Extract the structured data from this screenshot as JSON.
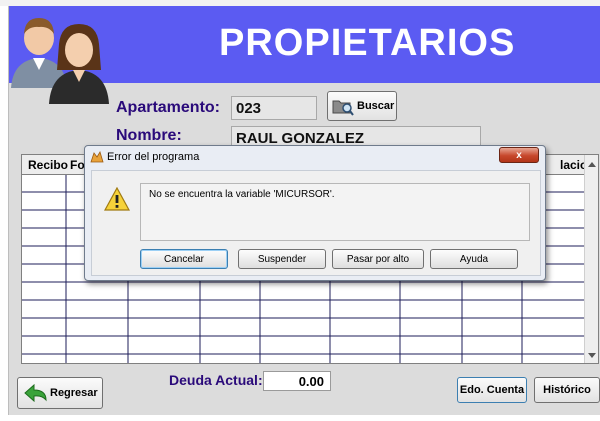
{
  "banner": {
    "title": "PROPIETARIOS"
  },
  "apartamento": {
    "label": "Apartamento:",
    "value": "023"
  },
  "buscar_button": {
    "label": "Buscar"
  },
  "nombre": {
    "label": "Nombre:",
    "value": "RAUL GONZALEZ"
  },
  "grid": {
    "headers": [
      "Recibo",
      "Fo",
      "lacion"
    ]
  },
  "dialog": {
    "title": "Error del programa",
    "message": "No se encuentra la variable 'MICURSOR'.",
    "buttons": {
      "cancel": "Cancelar",
      "suspend": "Suspender",
      "skip": "Pasar por alto",
      "help": "Ayuda"
    },
    "close": "x"
  },
  "footer": {
    "back_label": "Regresar",
    "deuda_label": "Deuda Actual:",
    "deuda_value": "0.00",
    "edo_cuenta_label": "Edo. Cuenta",
    "historico_label": "Histórico"
  },
  "colors": {
    "banner": "#5b5bf2",
    "label": "#2a0a7a",
    "close_button": "#c7472c"
  }
}
